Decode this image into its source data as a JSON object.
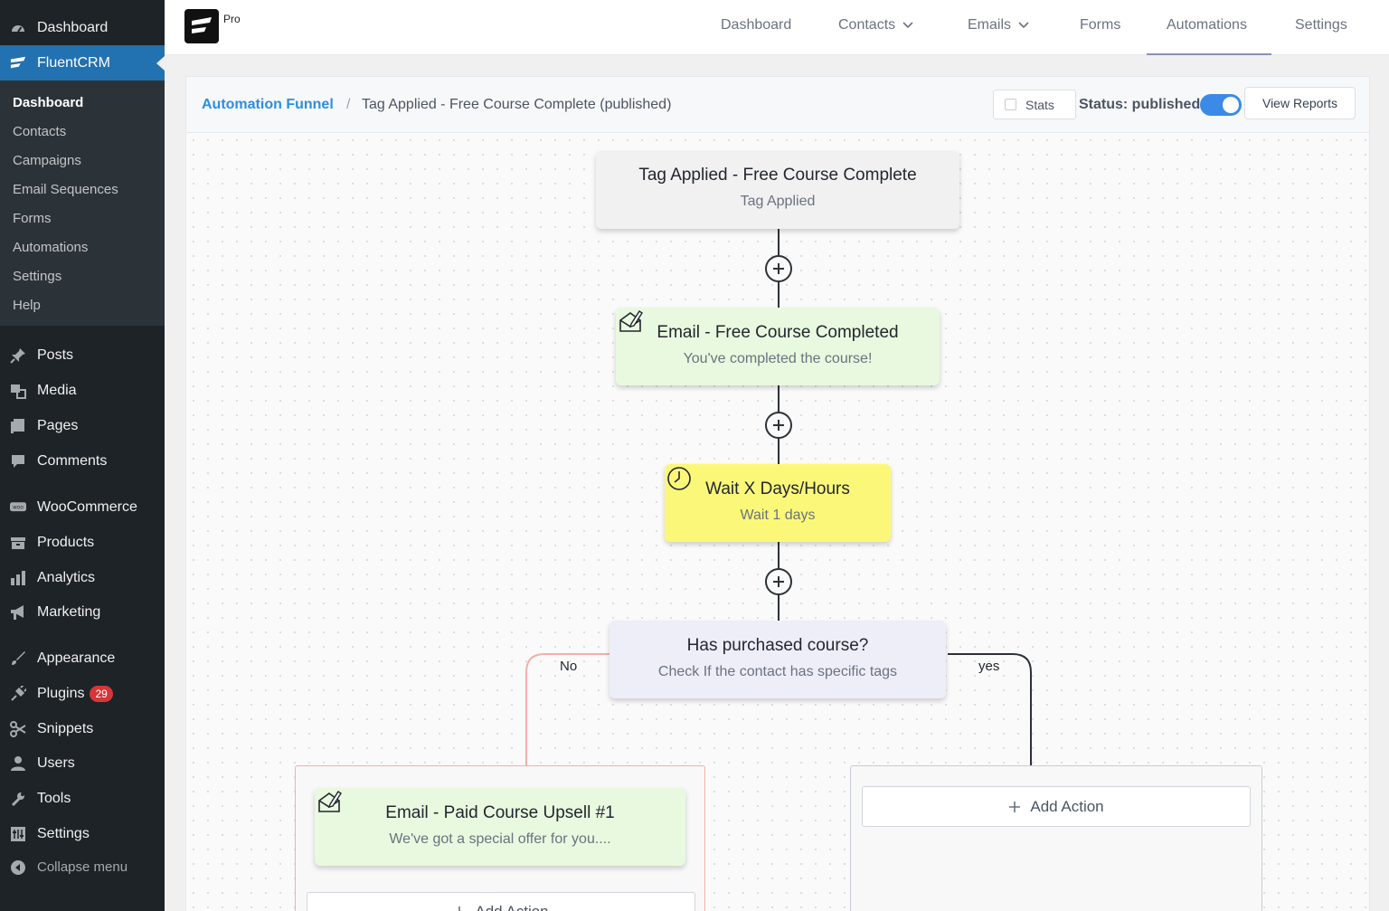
{
  "sidebar": {
    "top": [
      {
        "label": "Dashboard",
        "icon": "dashboard-icon"
      },
      {
        "label": "FluentCRM",
        "icon": "fluentcrm-icon"
      }
    ],
    "submenu": [
      "Dashboard",
      "Contacts",
      "Campaigns",
      "Email Sequences",
      "Forms",
      "Automations",
      "Settings",
      "Help"
    ],
    "items": [
      {
        "label": "Posts",
        "icon": "pin-icon"
      },
      {
        "label": "Media",
        "icon": "media-icon"
      },
      {
        "label": "Pages",
        "icon": "pages-icon"
      },
      {
        "label": "Comments",
        "icon": "comment-icon"
      },
      {
        "label": "WooCommerce",
        "icon": "woo-icon"
      },
      {
        "label": "Products",
        "icon": "archive-icon"
      },
      {
        "label": "Analytics",
        "icon": "bar-chart-icon"
      },
      {
        "label": "Marketing",
        "icon": "megaphone-icon"
      },
      {
        "label": "Appearance",
        "icon": "brush-icon"
      },
      {
        "label": "Plugins",
        "icon": "plug-icon",
        "badge": "29"
      },
      {
        "label": "Snippets",
        "icon": "scissors-icon"
      },
      {
        "label": "Users",
        "icon": "user-icon"
      },
      {
        "label": "Tools",
        "icon": "wrench-icon"
      },
      {
        "label": "Settings",
        "icon": "settings-icon"
      },
      {
        "label": "Collapse menu",
        "icon": "collapse-icon"
      }
    ]
  },
  "topnav": {
    "pro": "Pro",
    "items": [
      "Dashboard",
      "Contacts",
      "Emails",
      "Forms",
      "Automations",
      "Settings"
    ],
    "active": "Automations"
  },
  "header": {
    "breadcrumb_link": "Automation Funnel",
    "separator": "/",
    "breadcrumb_current": "Tag Applied - Free Course Complete (published)",
    "stats_label": "Stats",
    "status_label": "Status: published",
    "status_on": true,
    "view_reports": "View Reports"
  },
  "funnel": {
    "trigger": {
      "title": "Tag Applied - Free Course Complete",
      "subtitle": "Tag Applied"
    },
    "email1": {
      "title": "Email - Free Course Completed",
      "subtitle": "You've completed the course!"
    },
    "wait": {
      "title": "Wait X Days/Hours",
      "subtitle": "Wait 1 days"
    },
    "condition": {
      "title": "Has purchased course?",
      "subtitle": "Check If the contact has specific tags"
    },
    "no_label": "No",
    "yes_label": "yes",
    "no_email": {
      "title": "Email - Paid Course Upsell #1",
      "subtitle": "We've got a special offer for you...."
    },
    "no_add_action": "Add Action",
    "yes_add_action": "Add Action"
  },
  "colors": {
    "accent": "#2271b1",
    "link": "#2b8ee6",
    "trigger_bg": "#f1f1f1",
    "email_bg": "#e8f9df",
    "wait_bg": "#fbf879",
    "condition_bg": "#eeeef9",
    "no_branch": "#f0b0a8",
    "yes_branch": "#2d3238"
  }
}
